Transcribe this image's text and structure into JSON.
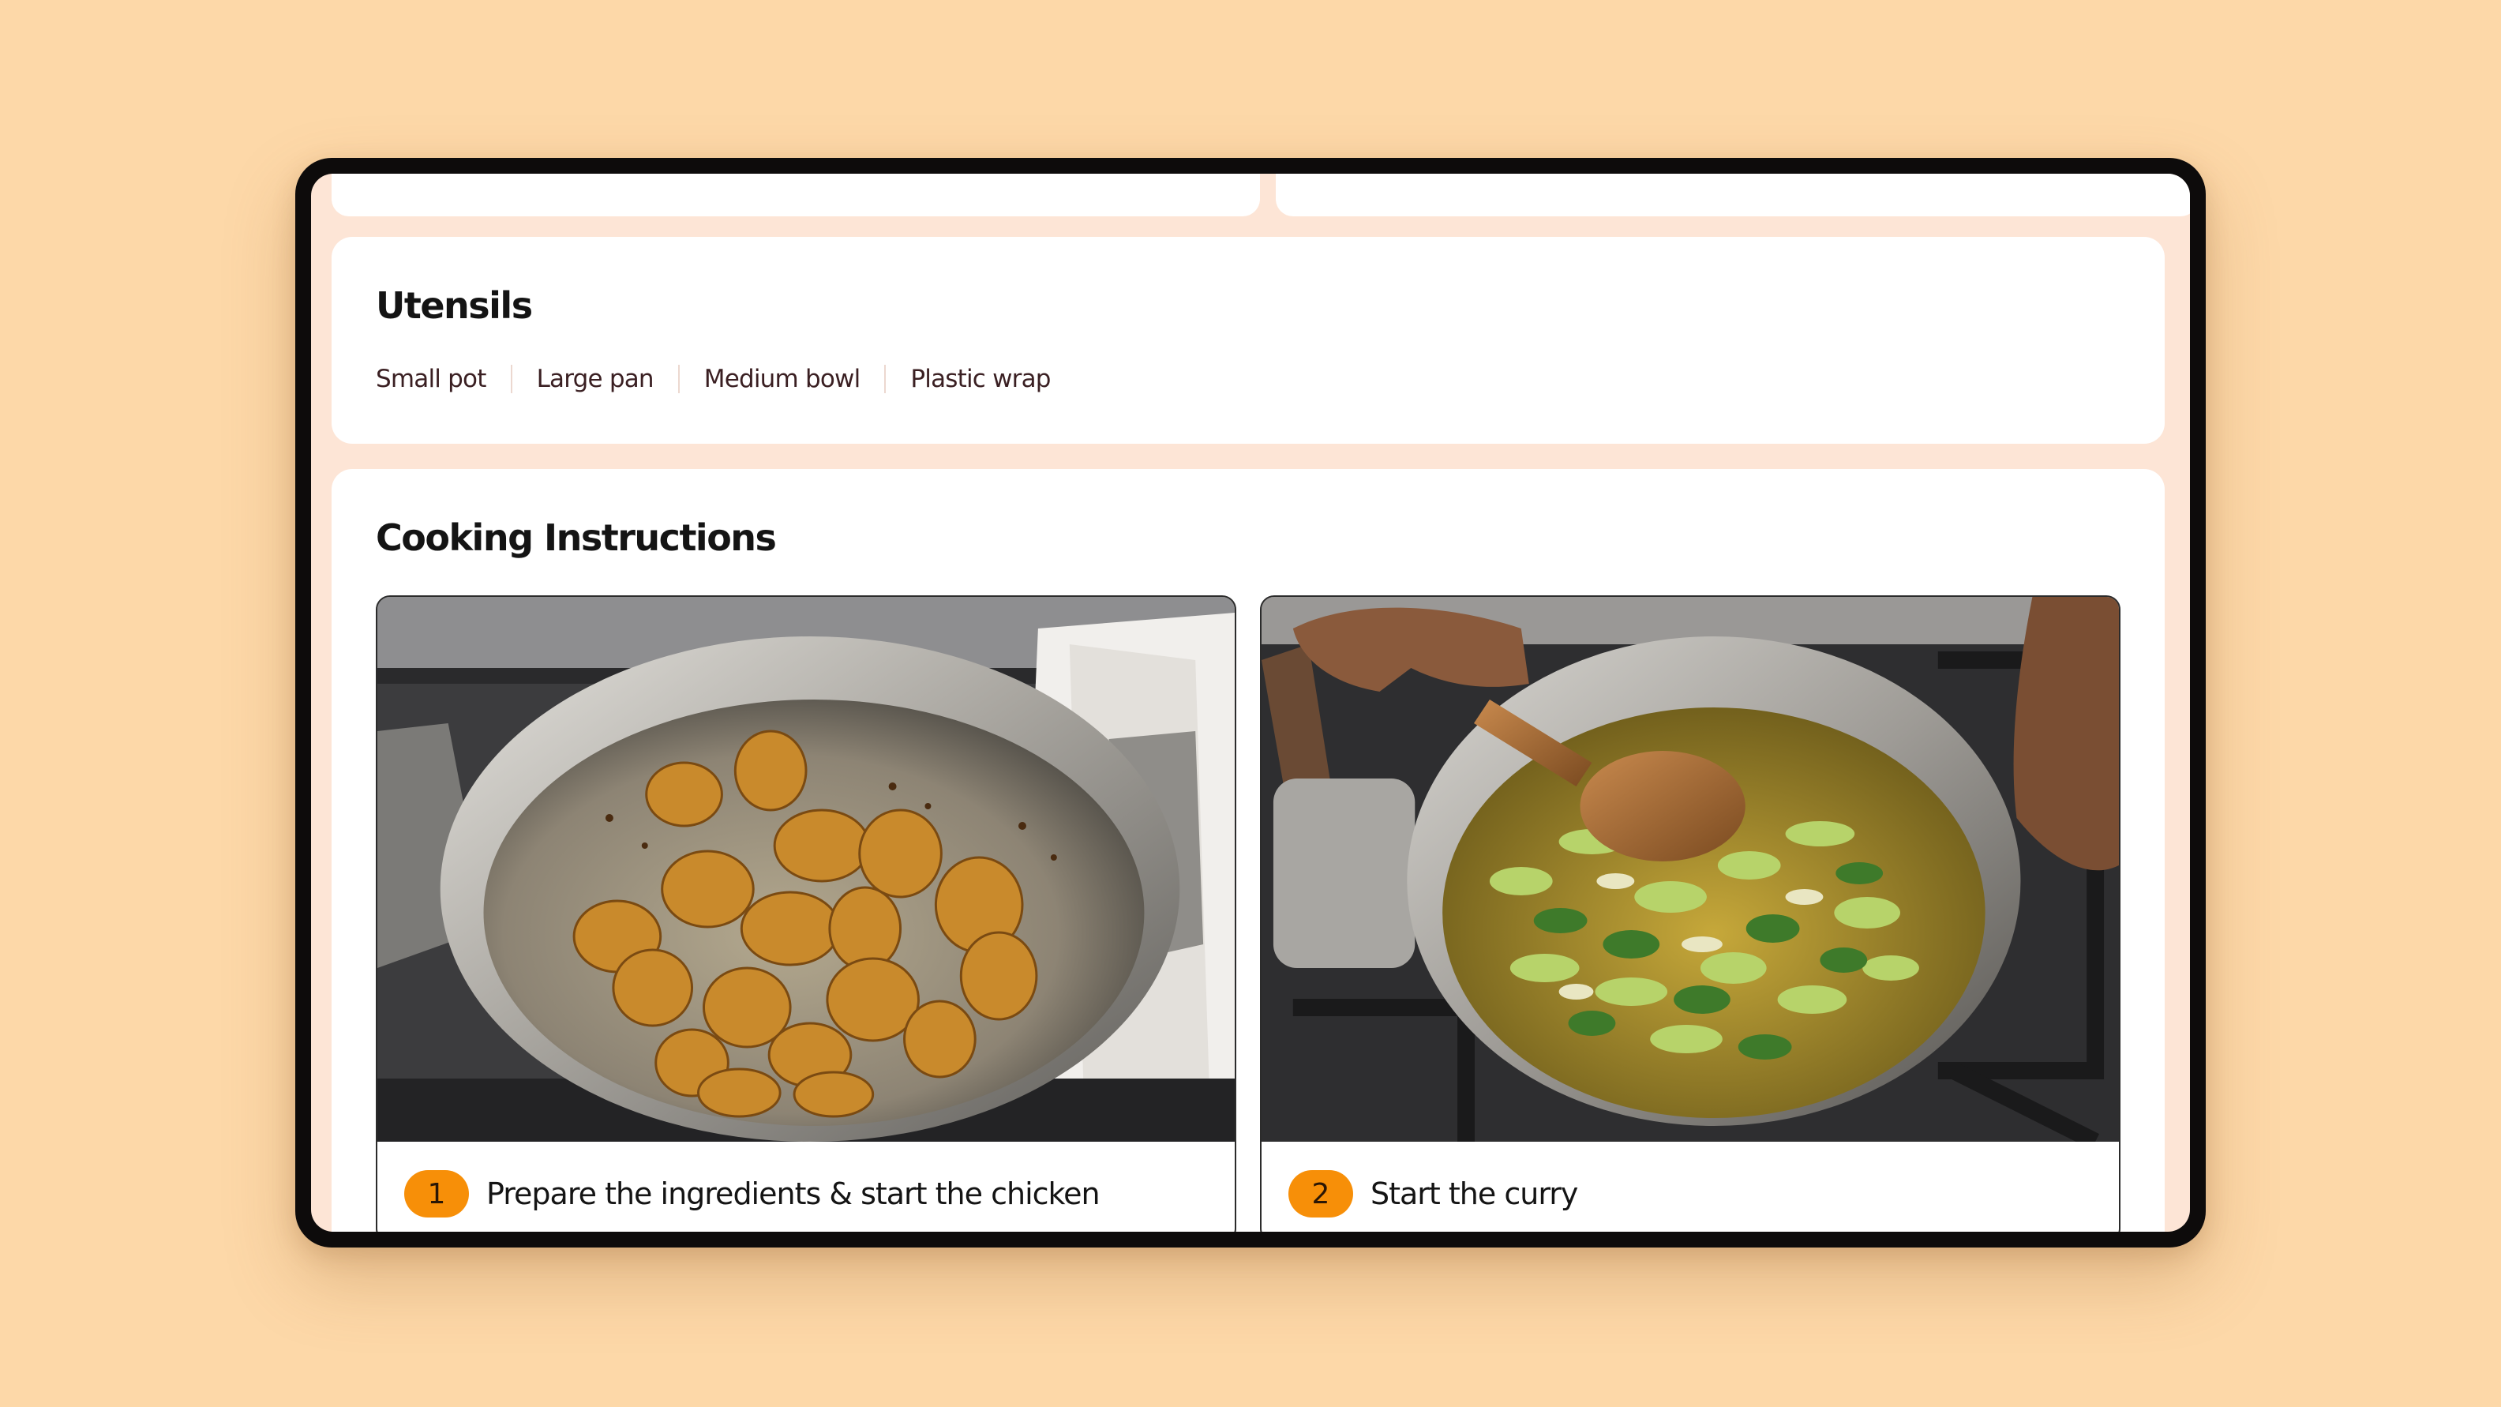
{
  "utensils": {
    "title": "Utensils",
    "items": [
      "Small pot",
      "Large pan",
      "Medium bowl",
      "Plastic wrap"
    ]
  },
  "instructions": {
    "title": "Cooking Instructions",
    "steps": [
      {
        "number": "1",
        "title": "Prepare the ingredients & start the chicken",
        "photo": "browned-chicken-in-pot"
      },
      {
        "number": "2",
        "title": "Start the curry",
        "photo": "vegetables-stirred-with-wooden-spoon"
      }
    ]
  },
  "colors": {
    "background": "#fdd8a8",
    "screen": "#fde5d6",
    "card": "#ffffff",
    "badge": "#f78f08",
    "text": "#141414",
    "utensil_text": "#3a1f22"
  }
}
